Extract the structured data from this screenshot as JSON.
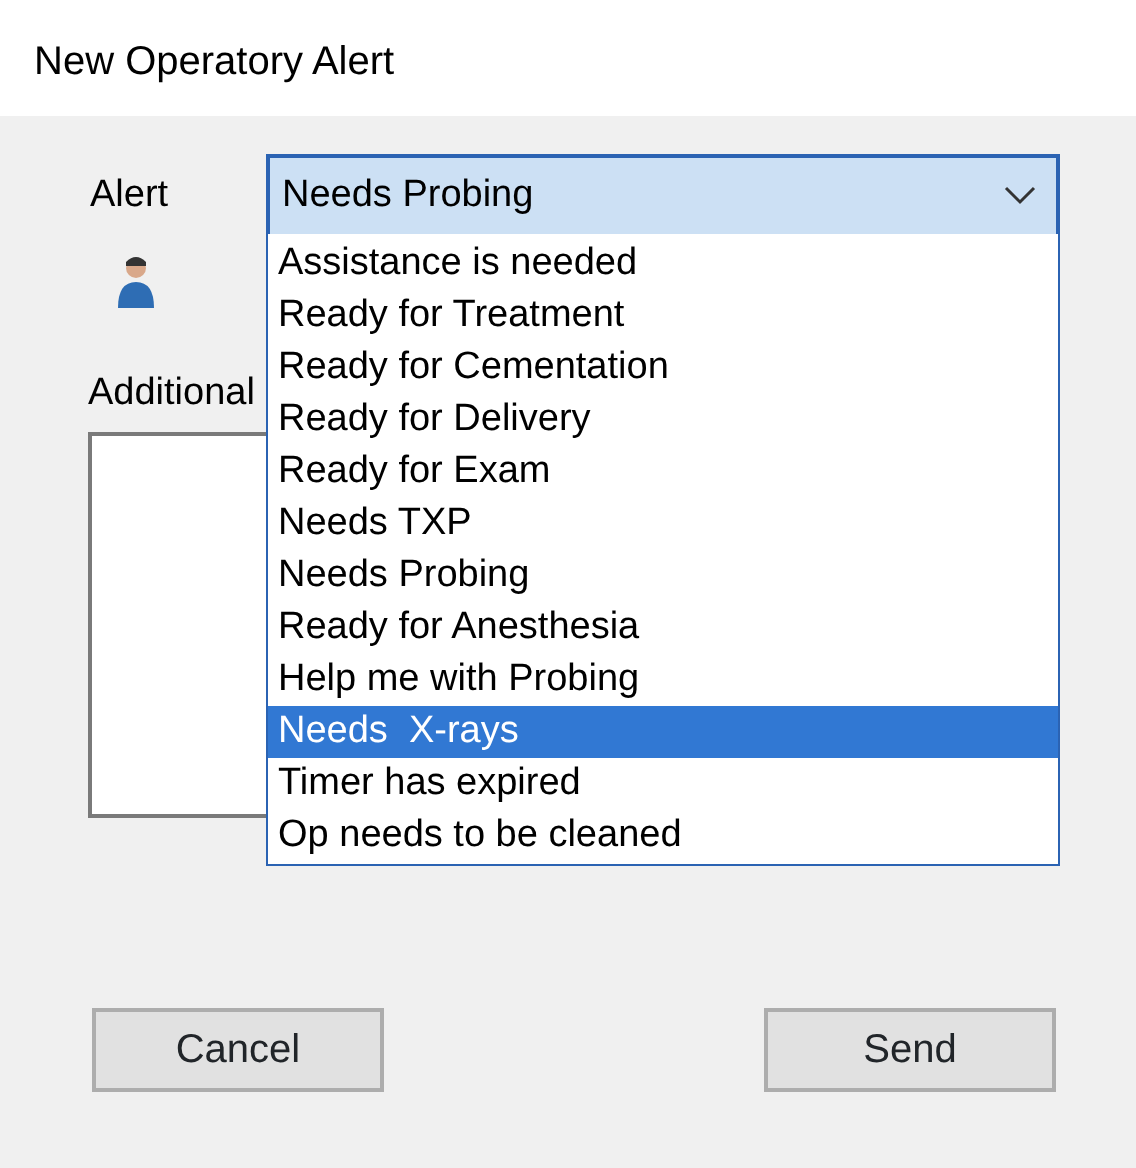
{
  "window": {
    "title": "New Operatory Alert"
  },
  "alert": {
    "label": "Alert",
    "value": "Needs Probing",
    "expanded": true,
    "options": [
      {
        "label": "Assistance is needed",
        "highlighted": false
      },
      {
        "label": "Ready for Treatment",
        "highlighted": false
      },
      {
        "label": "Ready for Cementation",
        "highlighted": false
      },
      {
        "label": "Ready for Delivery",
        "highlighted": false
      },
      {
        "label": "Ready for Exam",
        "highlighted": false
      },
      {
        "label": "Needs TXP",
        "highlighted": false
      },
      {
        "label": "Needs Probing",
        "highlighted": false
      },
      {
        "label": "Ready for Anesthesia",
        "highlighted": false
      },
      {
        "label": "Help me with Probing",
        "highlighted": false
      },
      {
        "label": "Needs  X-rays",
        "highlighted": true
      },
      {
        "label": "Timer has expired",
        "highlighted": false
      },
      {
        "label": "Op needs to be cleaned",
        "highlighted": false
      }
    ]
  },
  "additional": {
    "label": "Additional"
  },
  "buttons": [
    {
      "label": "Cancel"
    },
    {
      "label": "Send"
    }
  ]
}
